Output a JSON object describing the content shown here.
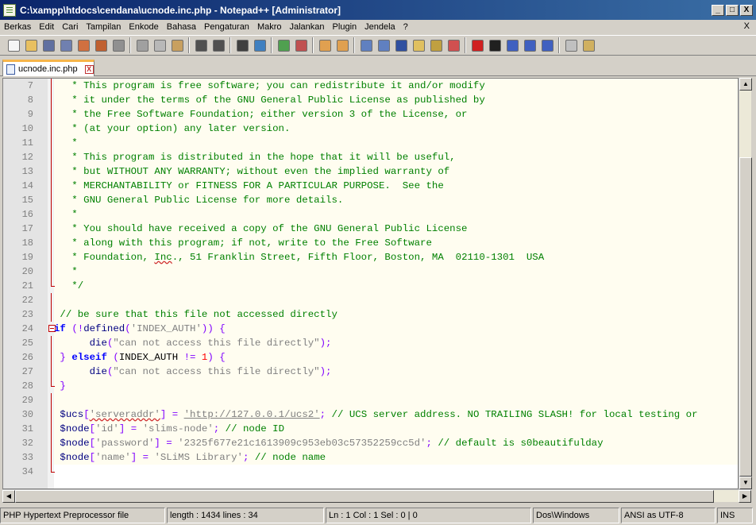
{
  "window": {
    "title": "C:\\xampp\\htdocs\\cendana\\ucnode.inc.php - Notepad++ [Administrator]",
    "minimize": "_",
    "maximize": "□",
    "close": "X"
  },
  "menu": {
    "items": [
      "Berkas",
      "Edit",
      "Cari",
      "Tampilan",
      "Enkode",
      "Bahasa",
      "Pengaturan",
      "Makro",
      "Jalankan",
      "Plugin",
      "Jendela",
      "?"
    ],
    "close_doc": "X"
  },
  "toolbar": {
    "buttons": [
      {
        "icon": "new-file-icon",
        "color": "#f5f5f5"
      },
      {
        "icon": "open-file-icon",
        "color": "#e8c060"
      },
      {
        "icon": "save-icon",
        "color": "#6070a0"
      },
      {
        "icon": "save-all-icon",
        "color": "#7080b0"
      },
      {
        "icon": "close-file-icon",
        "color": "#d07040"
      },
      {
        "icon": "close-all-icon",
        "color": "#c06030"
      },
      {
        "icon": "print-icon",
        "color": "#909090"
      },
      {
        "sep": true
      },
      {
        "icon": "cut-icon",
        "color": "#a0a0a0"
      },
      {
        "icon": "copy-icon",
        "color": "#b8b8b8"
      },
      {
        "icon": "paste-icon",
        "color": "#c8a060"
      },
      {
        "sep": true
      },
      {
        "icon": "undo-icon",
        "color": "#505050"
      },
      {
        "icon": "redo-icon",
        "color": "#505050"
      },
      {
        "sep": true
      },
      {
        "icon": "find-icon",
        "color": "#404040"
      },
      {
        "icon": "replace-icon",
        "color": "#4080c0"
      },
      {
        "sep": true
      },
      {
        "icon": "zoom-in-icon",
        "color": "#50a050"
      },
      {
        "icon": "zoom-out-icon",
        "color": "#c05050"
      },
      {
        "sep": true
      },
      {
        "icon": "sync-vertical-icon",
        "color": "#e0a050"
      },
      {
        "icon": "sync-horizontal-icon",
        "color": "#e0a050"
      },
      {
        "sep": true
      },
      {
        "icon": "word-wrap-icon",
        "color": "#6080c0"
      },
      {
        "icon": "show-all-chars-icon",
        "color": "#6080c0"
      },
      {
        "icon": "indent-guide-icon",
        "color": "#3050a0"
      },
      {
        "icon": "udl-icon",
        "color": "#e0c060"
      },
      {
        "icon": "doc-map-icon",
        "color": "#c0a040"
      },
      {
        "icon": "function-list-icon",
        "color": "#d05050"
      },
      {
        "sep": true
      },
      {
        "icon": "record-macro-icon",
        "color": "#d02020"
      },
      {
        "icon": "stop-record-icon",
        "color": "#202020"
      },
      {
        "icon": "play-macro-icon",
        "color": "#4060c0"
      },
      {
        "icon": "play-multiple-icon",
        "color": "#4060c0"
      },
      {
        "icon": "save-macro-icon",
        "color": "#4060c0"
      },
      {
        "sep": true
      },
      {
        "icon": "spell-check-icon",
        "color": "#c0c0c0"
      },
      {
        "icon": "spell-check-auto-icon",
        "color": "#d0b060"
      }
    ]
  },
  "tab": {
    "label": "ucnode.inc.php",
    "close": "X"
  },
  "editor": {
    "lines": [
      {
        "n": "7",
        "fold": "bar",
        "parts": [
          [
            "cm",
            "   * This program is free software; you can redistribute it and/or modify"
          ]
        ]
      },
      {
        "n": "8",
        "fold": "bar",
        "parts": [
          [
            "cm",
            "   * it under the terms of the GNU General Public License as published by"
          ]
        ]
      },
      {
        "n": "9",
        "fold": "bar",
        "parts": [
          [
            "cm",
            "   * the Free Software Foundation; either version 3 of the License, or"
          ]
        ]
      },
      {
        "n": "10",
        "fold": "bar",
        "parts": [
          [
            "cm",
            "   * (at your option) any later version."
          ]
        ]
      },
      {
        "n": "11",
        "fold": "bar",
        "parts": [
          [
            "cm",
            "   *"
          ]
        ]
      },
      {
        "n": "12",
        "fold": "bar",
        "parts": [
          [
            "cm",
            "   * This program is distributed in the hope that it will be useful,"
          ]
        ]
      },
      {
        "n": "13",
        "fold": "bar",
        "parts": [
          [
            "cm",
            "   * but WITHOUT ANY WARRANTY; without even the implied warranty of"
          ]
        ]
      },
      {
        "n": "14",
        "fold": "bar",
        "parts": [
          [
            "cm",
            "   * MERCHANTABILITY or FITNESS FOR A PARTICULAR PURPOSE.  See the"
          ]
        ]
      },
      {
        "n": "15",
        "fold": "bar",
        "parts": [
          [
            "cm",
            "   * GNU General Public License for more details."
          ]
        ]
      },
      {
        "n": "16",
        "fold": "bar",
        "parts": [
          [
            "cm",
            "   *"
          ]
        ]
      },
      {
        "n": "17",
        "fold": "bar",
        "parts": [
          [
            "cm",
            "   * You should have received a copy of the GNU General Public License"
          ]
        ]
      },
      {
        "n": "18",
        "fold": "bar",
        "parts": [
          [
            "cm",
            "   * along with this program; if not, write to the Free Software"
          ]
        ]
      },
      {
        "n": "19",
        "fold": "bar",
        "parts": [
          [
            "cm",
            "   * Foundation, "
          ],
          [
            "cm ul",
            "Inc"
          ],
          [
            "cm",
            "., 51 Franklin Street, Fifth Floor, Boston, MA  02110-1301  USA"
          ]
        ]
      },
      {
        "n": "20",
        "fold": "bar",
        "parts": [
          [
            "cm",
            "   *"
          ]
        ]
      },
      {
        "n": "21",
        "fold": "end",
        "parts": [
          [
            "cm",
            "   */"
          ]
        ]
      },
      {
        "n": "22",
        "fold": "bar",
        "parts": [
          [
            "",
            ""
          ]
        ]
      },
      {
        "n": "23",
        "fold": "bar",
        "parts": [
          [
            "cm",
            " // be sure that this file not accessed directly"
          ]
        ]
      },
      {
        "n": "24",
        "fold": "box",
        "parts": [
          [
            "kw",
            "if"
          ],
          [
            "",
            " "
          ],
          [
            "op",
            "("
          ],
          [
            "op",
            "!"
          ],
          [
            "bi",
            "defined"
          ],
          [
            "op",
            "("
          ],
          [
            "st",
            "'INDEX_AUTH'"
          ],
          [
            "op",
            "))"
          ],
          [
            "",
            " "
          ],
          [
            "op",
            "{"
          ]
        ]
      },
      {
        "n": "25",
        "fold": "bar",
        "parts": [
          [
            "",
            "      "
          ],
          [
            "bi",
            "die"
          ],
          [
            "op",
            "("
          ],
          [
            "st",
            "\"can not access this file directly\""
          ],
          [
            "op",
            ");"
          ]
        ]
      },
      {
        "n": "26",
        "fold": "bar",
        "parts": [
          [
            "op",
            " }"
          ],
          [
            "",
            " "
          ],
          [
            "kw",
            "elseif"
          ],
          [
            "",
            " "
          ],
          [
            "op",
            "("
          ],
          [
            "",
            "INDEX_AUTH "
          ],
          [
            "op",
            "!="
          ],
          [
            "",
            " "
          ],
          [
            "nu",
            "1"
          ],
          [
            "op",
            ")"
          ],
          [
            "",
            " "
          ],
          [
            "op",
            "{"
          ]
        ]
      },
      {
        "n": "27",
        "fold": "bar",
        "parts": [
          [
            "",
            "      "
          ],
          [
            "bi",
            "die"
          ],
          [
            "op",
            "("
          ],
          [
            "st",
            "\"can not access this file directly\""
          ],
          [
            "op",
            ");"
          ]
        ]
      },
      {
        "n": "28",
        "fold": "end",
        "parts": [
          [
            "op",
            " }"
          ]
        ]
      },
      {
        "n": "29",
        "fold": "bar",
        "parts": [
          [
            "",
            ""
          ]
        ]
      },
      {
        "n": "30",
        "fold": "bar",
        "parts": [
          [
            "va",
            " $ucs"
          ],
          [
            "op",
            "["
          ],
          [
            "st ul",
            "'serveraddr'"
          ],
          [
            "op",
            "]"
          ],
          [
            "",
            " "
          ],
          [
            "op",
            "="
          ],
          [
            "",
            " "
          ],
          [
            "st ulst",
            "'http://127.0.0.1/ucs2'"
          ],
          [
            "op",
            ";"
          ],
          [
            "",
            " "
          ],
          [
            "cm",
            "// UCS server address. NO TRAILING SLASH! for local testing or"
          ]
        ]
      },
      {
        "n": "31",
        "fold": "bar",
        "parts": [
          [
            "va",
            " $node"
          ],
          [
            "op",
            "["
          ],
          [
            "st",
            "'id'"
          ],
          [
            "op",
            "]"
          ],
          [
            "",
            " "
          ],
          [
            "op",
            "="
          ],
          [
            "",
            " "
          ],
          [
            "st",
            "'slims-node'"
          ],
          [
            "op",
            ";"
          ],
          [
            "",
            " "
          ],
          [
            "cm",
            "// node ID"
          ]
        ]
      },
      {
        "n": "32",
        "fold": "bar",
        "parts": [
          [
            "va",
            " $node"
          ],
          [
            "op",
            "["
          ],
          [
            "st",
            "'password'"
          ],
          [
            "op",
            "]"
          ],
          [
            "",
            " "
          ],
          [
            "op",
            "="
          ],
          [
            "",
            " "
          ],
          [
            "st",
            "'2325f677e21c1613909c953eb03c57352259cc5d'"
          ],
          [
            "op",
            ";"
          ],
          [
            "",
            " "
          ],
          [
            "cm",
            "// default is s0beautifulday"
          ]
        ]
      },
      {
        "n": "33",
        "fold": "bar",
        "parts": [
          [
            "va",
            " $node"
          ],
          [
            "op",
            "["
          ],
          [
            "st",
            "'name'"
          ],
          [
            "op",
            "]"
          ],
          [
            "",
            " "
          ],
          [
            "op",
            "="
          ],
          [
            "",
            " "
          ],
          [
            "st",
            "'SLiMS Library'"
          ],
          [
            "op",
            ";"
          ],
          [
            "",
            " "
          ],
          [
            "cm",
            "// node name"
          ]
        ]
      },
      {
        "n": "34",
        "fold": "end",
        "last": true,
        "parts": [
          [
            "",
            ""
          ]
        ]
      }
    ]
  },
  "scroll": {
    "up": "▲",
    "down": "▼",
    "left": "◀",
    "right": "▶"
  },
  "status": {
    "file_type": "PHP Hypertext Preprocessor file",
    "length_lines": "length : 1434    lines : 34",
    "position": "Ln : 1    Col : 1    Sel : 0 | 0",
    "eol": "Dos\\Windows",
    "encoding": "ANSI as UTF-8",
    "mode": "INS"
  }
}
